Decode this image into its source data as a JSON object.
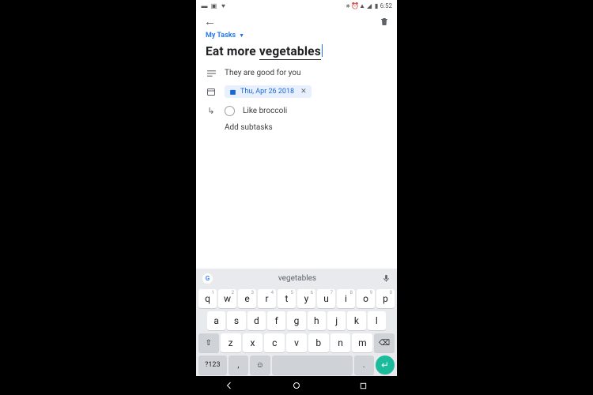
{
  "status": {
    "time": "6:52"
  },
  "list_selector": "My Tasks",
  "task": {
    "title_plain": "Eat more ",
    "title_underlined": "vegetables",
    "details": "They are good for you",
    "date": "Thu, Apr 26 2018",
    "subtasks": [
      {
        "label": "Like broccoli",
        "done": false
      }
    ],
    "add_subtasks_label": "Add subtasks"
  },
  "keyboard": {
    "suggestion": "vegetables",
    "row1": [
      "q",
      "w",
      "e",
      "r",
      "t",
      "y",
      "u",
      "i",
      "o",
      "p"
    ],
    "row1_nums": [
      "1",
      "2",
      "3",
      "4",
      "5",
      "6",
      "7",
      "8",
      "9",
      "0"
    ],
    "row2": [
      "a",
      "s",
      "d",
      "f",
      "g",
      "h",
      "j",
      "k",
      "l"
    ],
    "row3": [
      "z",
      "x",
      "c",
      "v",
      "b",
      "n",
      "m"
    ],
    "symbols_key": "?123",
    "comma": ",",
    "period": "."
  }
}
